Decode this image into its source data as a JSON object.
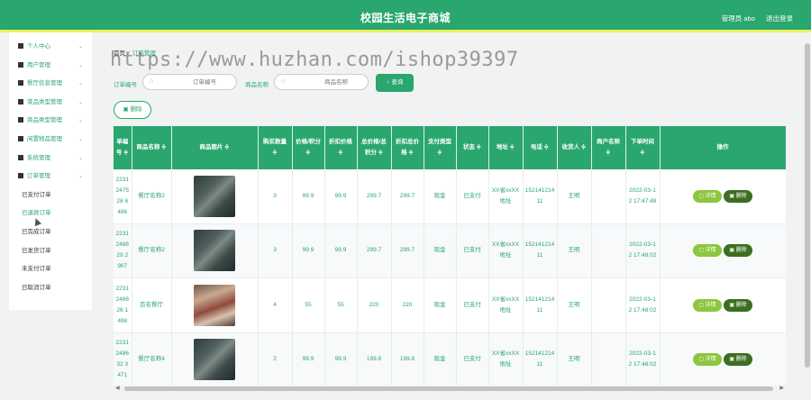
{
  "header": {
    "title": "校园生活电子商城",
    "admin_label": "管理员 abo",
    "logout_label": "退出登录"
  },
  "sidebar": {
    "menu": [
      {
        "label": "个人中心"
      },
      {
        "label": "用户管理"
      },
      {
        "label": "餐厅信息管理"
      },
      {
        "label": "菜品类型管理"
      },
      {
        "label": "商品类型管理"
      },
      {
        "label": "闲置物品管理"
      },
      {
        "label": "系统管理"
      },
      {
        "label": "订单管理"
      }
    ],
    "submenu": [
      "已支付订单",
      "已退款订单",
      "已完成订单",
      "已发货订单",
      "未支付订单",
      "已取消订单"
    ]
  },
  "breadcrumb": {
    "home": "首页",
    "sep": "/",
    "current": "订单管理"
  },
  "watermark": "https://www.huzhan.com/ishop39397",
  "search": {
    "order_no_label": "订单编号",
    "order_no_placeholder": "订单编号",
    "product_label": "商品名称",
    "product_placeholder": "商品名称",
    "button_label": "查询"
  },
  "delete_button": "删除",
  "table": {
    "headers": [
      "单编号 ≑",
      "商品名称 ≑",
      "商品图片 ≑",
      "购买数量 ≑",
      "价格/积分 ≑",
      "折扣价格 ≑",
      "总价格/总积分 ≑",
      "折扣总价格 ≑",
      "支付类型 ≑",
      "状态 ≑",
      "地址 ≑",
      "电话 ≑",
      "收货人 ≑",
      "商户名称 ≑",
      "下单时间 ≑",
      "操作"
    ],
    "rows": [
      {
        "order_no": "2231247528 6496",
        "name": "餐厅名称2",
        "img": "dark",
        "qty": "3",
        "price": "99.9",
        "discount": "99.9",
        "total": "299.7",
        "discount_total": "299.7",
        "pay": "现金",
        "status": "已支付",
        "address": "XX省xxXX地址",
        "phone": "15214121411",
        "receiver": "王明",
        "merchant": "",
        "time": "2022-03-12 17:47:48"
      },
      {
        "order_no": "2231248629 2907",
        "name": "餐厅名称2",
        "img": "dark",
        "qty": "3",
        "price": "99.9",
        "discount": "99.9",
        "total": "299.7",
        "discount_total": "299.7",
        "pay": "现金",
        "status": "已支付",
        "address": "XX省xxXX地址",
        "phone": "15214121411",
        "receiver": "王明",
        "merchant": "",
        "time": "2022-03-12 17:48:02"
      },
      {
        "order_no": "2231248626 1498",
        "name": "百名餐厅",
        "img": "warm",
        "qty": "4",
        "price": "55",
        "discount": "55",
        "total": "220",
        "discount_total": "220",
        "pay": "现金",
        "status": "已支付",
        "address": "XX省xxXX地址",
        "phone": "15214121411",
        "receiver": "王明",
        "merchant": "",
        "time": "2022-03-12 17:48:02"
      },
      {
        "order_no": "2231248632 3471",
        "name": "餐厅名称4",
        "img": "dark",
        "qty": "2",
        "price": "99.9",
        "discount": "99.9",
        "total": "199.8",
        "discount_total": "199.8",
        "pay": "现金",
        "status": "已支付",
        "address": "XX省xxXX地址",
        "phone": "15214121411",
        "receiver": "王明",
        "merchant": "",
        "time": "2022-03-12 17:48:02"
      }
    ],
    "detail_label": "详情",
    "delete_label": "删除"
  }
}
